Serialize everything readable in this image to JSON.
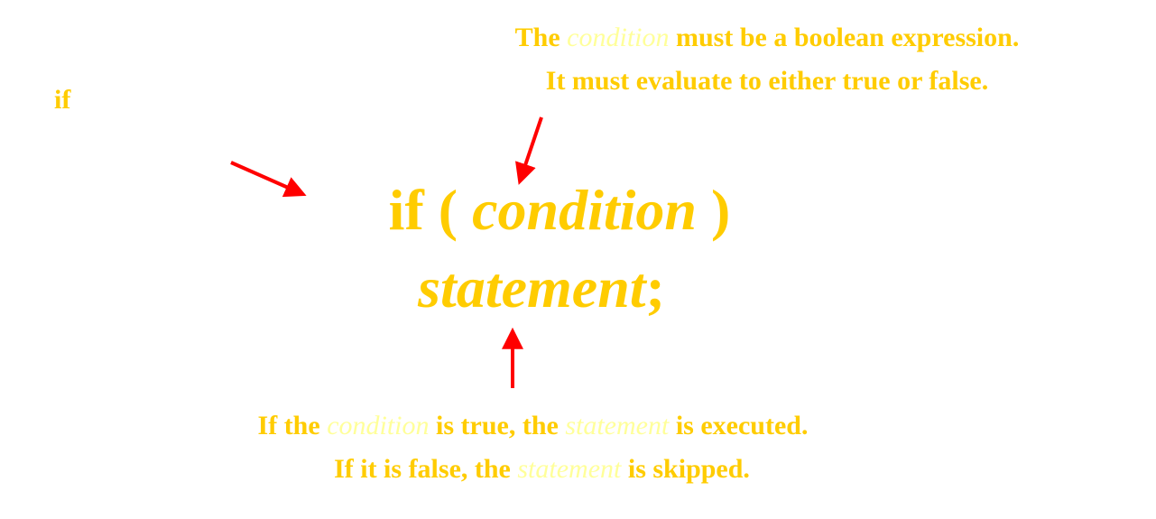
{
  "colors": {
    "gold": "#ffcc00",
    "pale": "#ffff99",
    "arrow": "#ff0000"
  },
  "keyword": {
    "text": "if"
  },
  "syntax": {
    "line1": {
      "keyword": "if",
      "open": " ( ",
      "condition": "condition",
      "close": " )"
    },
    "line2": {
      "statement": "statement",
      "terminator": ";"
    }
  },
  "note_top": {
    "line1": {
      "the": "The ",
      "term": "condition",
      "rest": " must be a boolean expression."
    },
    "line2": "It must evaluate to either true or false."
  },
  "note_bottom": {
    "line1": {
      "a": "If the ",
      "term1": "condition",
      "b": " is true, the ",
      "term2": "statement",
      "c": " is executed."
    },
    "line2": {
      "a": "If it is false, the ",
      "term": "statement",
      "b": " is skipped."
    }
  },
  "arrows": [
    {
      "name": "arrow-to-if",
      "points_to": "if"
    },
    {
      "name": "arrow-to-condition",
      "points_to": "condition"
    },
    {
      "name": "arrow-to-statement",
      "points_to": "statement"
    }
  ]
}
